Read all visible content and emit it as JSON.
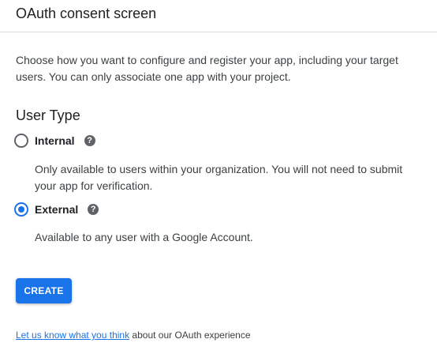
{
  "header": {
    "title": "OAuth consent screen"
  },
  "intro": {
    "text": "Choose how you want to configure and register your app, including your target users. You can only associate one app with your project."
  },
  "user_type": {
    "heading": "User Type",
    "options": [
      {
        "label": "Internal",
        "selected": false,
        "help_icon": "help-circle-icon",
        "description": "Only available to users within your organization. You will not need to submit your app for verification."
      },
      {
        "label": "External",
        "selected": true,
        "help_icon": "help-circle-icon",
        "description": "Available to any user with a Google Account."
      }
    ]
  },
  "actions": {
    "create_label": "CREATE"
  },
  "feedback": {
    "link_text": "Let us know what you think",
    "suffix_text": " about our OAuth experience"
  },
  "colors": {
    "accent": "#1a73e8",
    "text_primary": "#202124",
    "text_secondary": "#3c4043",
    "icon_gray": "#5f6368",
    "divider": "#dadce0"
  }
}
